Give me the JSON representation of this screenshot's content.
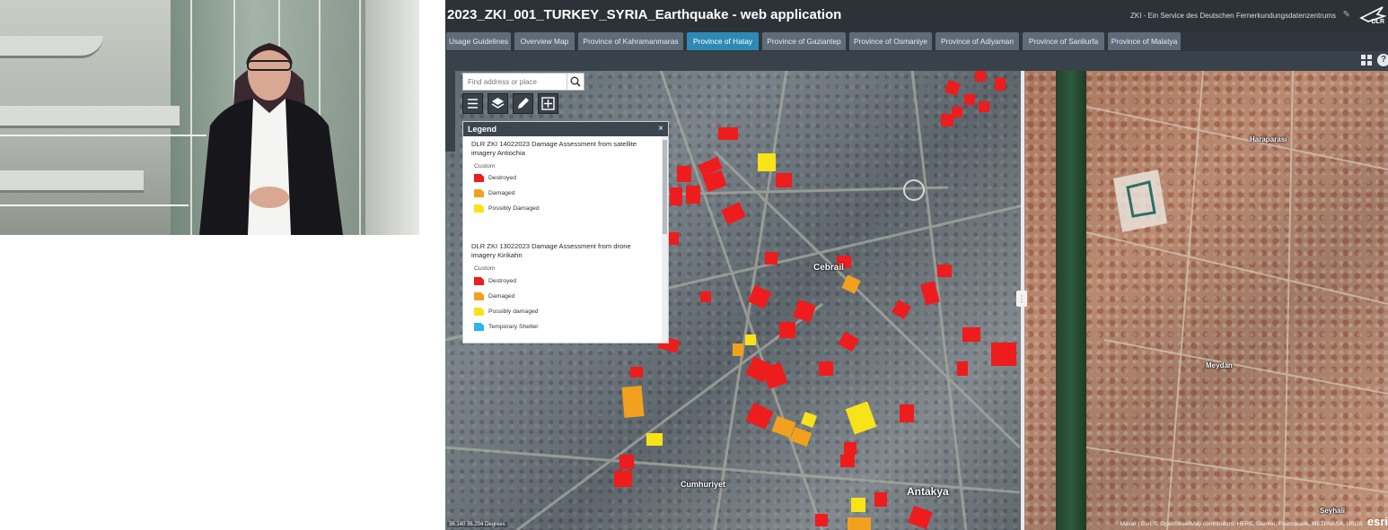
{
  "app": {
    "title": "2023_ZKI_001_TURKEY_SYRIA_Earthquake - web application",
    "subtitle": "ZKI - Ein Service des Deutschen Fernerkundungsdatenzentrums",
    "logo_text": "DLR",
    "tabs": [
      {
        "label": "Usage Guidelines",
        "active": false
      },
      {
        "label": "Overview Map",
        "active": false
      },
      {
        "label": "Province of Kahramanmaras",
        "active": false
      },
      {
        "label": "Province of Hatay",
        "active": true
      },
      {
        "label": "Province of Gaziantep",
        "active": false
      },
      {
        "label": "Province of Osmaniye",
        "active": false
      },
      {
        "label": "Province of Adiyaman",
        "active": false
      },
      {
        "label": "Province of Sanliurfa",
        "active": false
      },
      {
        "label": "Province of Malatya",
        "active": false
      }
    ],
    "active_tab_color": "#2d8ab5"
  },
  "map": {
    "search_placeholder": "Find address or place",
    "place_labels": {
      "cebrail": "Cebrail",
      "cumhuriyet": "Cumhuriyet",
      "antakya": "Antakya",
      "haraparasi": "Haraparası",
      "meydan": "Meydan",
      "seyhali": "Seyhali"
    },
    "coordinates": "36.140 36.204 Degrees",
    "attribution": "Maxar | Esri, © OpenStreetMap contributors, HERE, Garmin, Foursquare, METI/NASA, USGS",
    "esri_logo": "esri"
  },
  "legend": {
    "title": "Legend",
    "layers": [
      {
        "name": "DLR ZKI 14022023 Damage Assessment from satellite imagery Antiochia",
        "group": "Custom",
        "items": [
          {
            "label": "Destroyed",
            "color": "#ee1c1c"
          },
          {
            "label": "Damaged",
            "color": "#f2a11e"
          },
          {
            "label": "Possibly Damaged",
            "color": "#f7e318"
          }
        ]
      },
      {
        "name": "DLR ZKI 13022023 Damage Assessment from drone imagery Kirikahn",
        "group": "Custom",
        "items": [
          {
            "label": "Destroyed",
            "color": "#ee1c1c"
          },
          {
            "label": "Damaged",
            "color": "#f2a11e"
          },
          {
            "label": "Possibly damaged",
            "color": "#f7e318"
          },
          {
            "label": "Temporary Shelter",
            "color": "#2ab6ee"
          }
        ]
      }
    ]
  }
}
